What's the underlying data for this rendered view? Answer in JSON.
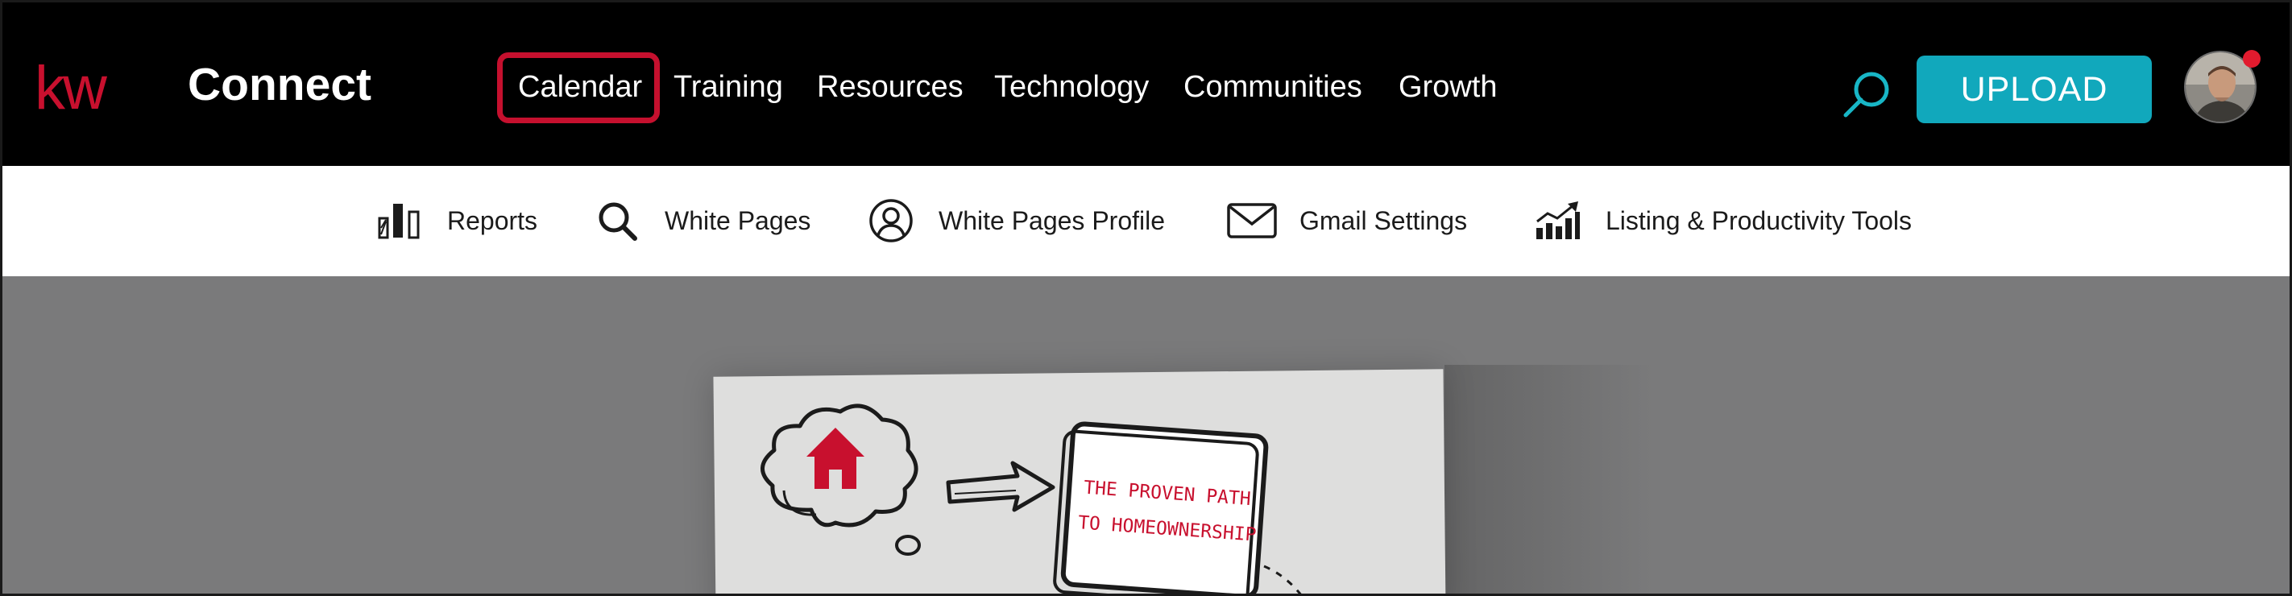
{
  "app": {
    "brand_name": "Connect",
    "logo_text": "kw"
  },
  "nav": {
    "items": [
      {
        "label": "Calendar",
        "highlighted": true
      },
      {
        "label": "Training"
      },
      {
        "label": "Resources"
      },
      {
        "label": "Technology"
      },
      {
        "label": "Communities"
      },
      {
        "label": "Growth"
      }
    ],
    "highlight_color": "#c5102e"
  },
  "header": {
    "search_icon": "search-icon",
    "upload_label": "UPLOAD",
    "upload_color": "#11a8bc",
    "notification_dot_color": "#e21b2e"
  },
  "subnav": {
    "items": [
      {
        "label": "Reports",
        "icon": "reports-bar-chart-icon"
      },
      {
        "label": "White Pages",
        "icon": "magnifier-icon"
      },
      {
        "label": "White Pages Profile",
        "icon": "user-circle-icon"
      },
      {
        "label": "Gmail Settings",
        "icon": "envelope-icon"
      },
      {
        "label": "Listing & Productivity Tools",
        "icon": "trending-chart-icon"
      }
    ]
  },
  "hero": {
    "sign_line1": "THE PROVEN PATH",
    "sign_line2": "TO HOMEOWNERSHIP"
  }
}
